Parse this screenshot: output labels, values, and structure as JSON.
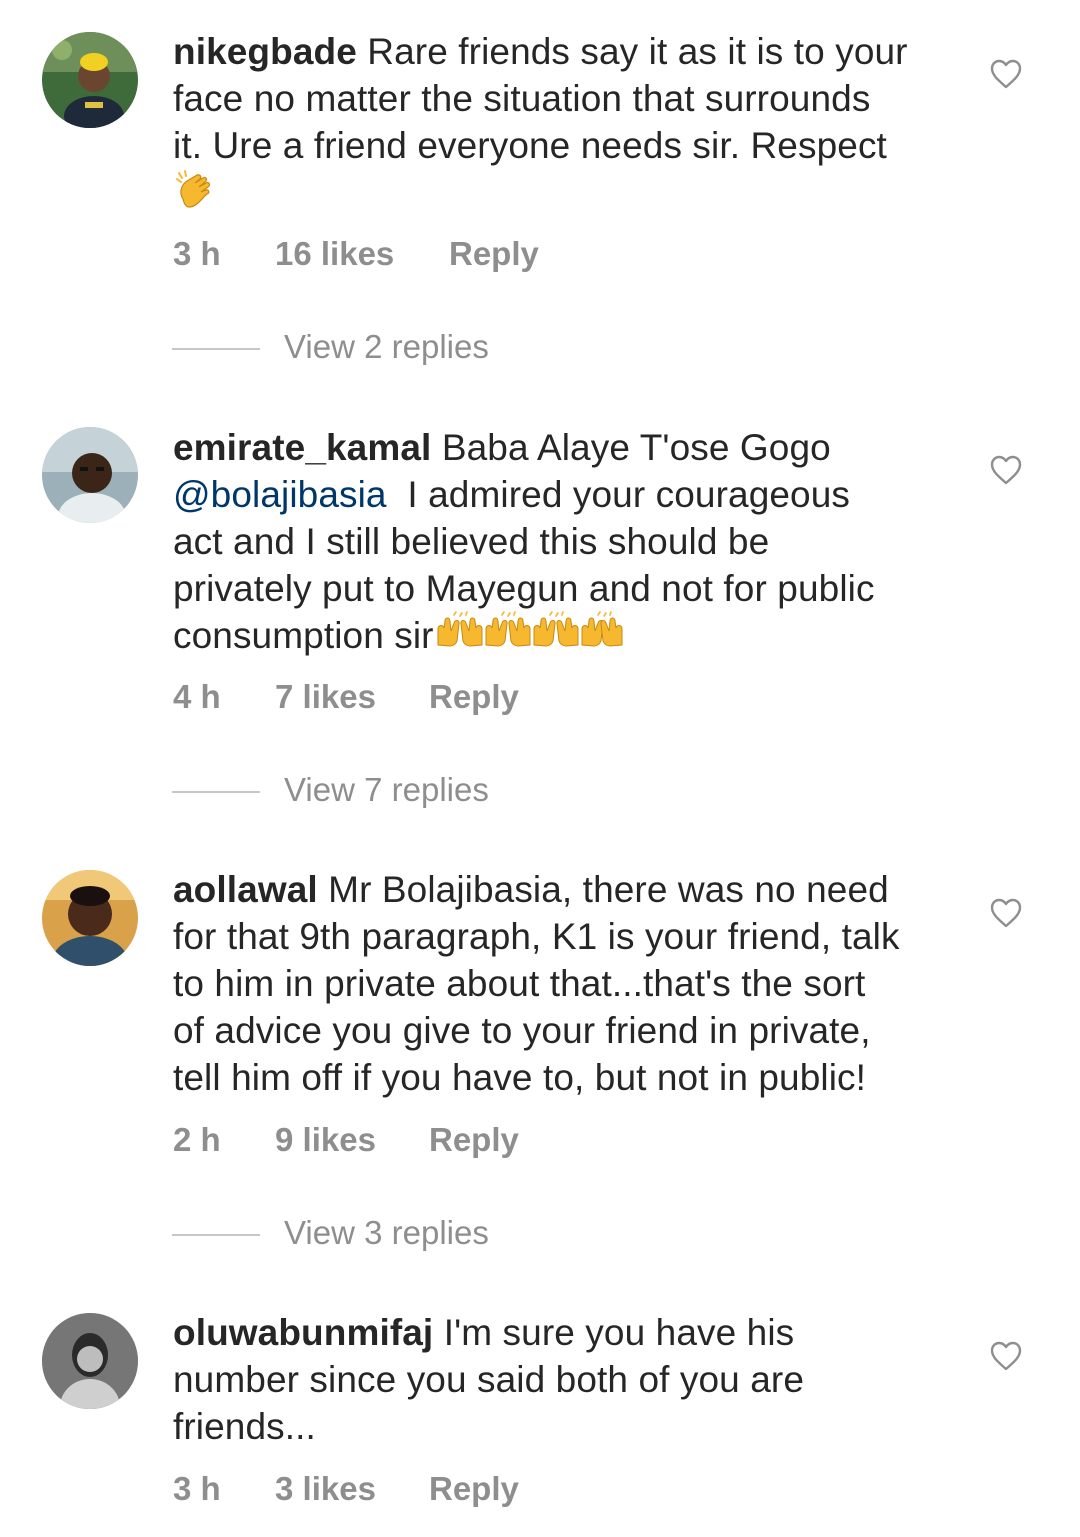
{
  "comments": [
    {
      "username": "nikegbade",
      "lines": [
        {
          "pre": "Rare friends say it as it is to your",
          "mention": "",
          "post": ""
        },
        {
          "pre": "face no matter the situation that surrounds",
          "mention": "",
          "post": ""
        },
        {
          "pre": "it.  Ure a friend everyone needs sir. Respect",
          "mention": "",
          "post": ""
        }
      ],
      "emoji": "👏",
      "time": "3 h",
      "likes": "16 likes",
      "reply": "Reply",
      "view_replies": "View 2 replies"
    },
    {
      "username": "emirate_kamal",
      "lines": [
        {
          "pre": "Baba Alaye T'ose Gogo",
          "mention": "",
          "post": ""
        },
        {
          "pre": "",
          "mention": "@bolajibasia",
          "post": "  I admired your courageous"
        },
        {
          "pre": "act and I still believed this should be",
          "mention": "",
          "post": ""
        },
        {
          "pre": "privately put to Mayegun and not for public",
          "mention": "",
          "post": ""
        },
        {
          "pre": "consumption sir",
          "mention": "",
          "post": ""
        }
      ],
      "emoji": "🙌🙌🙌🙌",
      "time": "4 h",
      "likes": "7 likes",
      "reply": "Reply",
      "view_replies": "View 7 replies"
    },
    {
      "username": "aollawal",
      "lines": [
        {
          "pre": "Mr Bolajibasia, there was no need",
          "mention": "",
          "post": ""
        },
        {
          "pre": "for that 9th paragraph, K1 is your friend, talk",
          "mention": "",
          "post": ""
        },
        {
          "pre": "to him in private about that...that's the sort",
          "mention": "",
          "post": ""
        },
        {
          "pre": "of advice you give to your friend in private,",
          "mention": "",
          "post": ""
        },
        {
          "pre": "tell him off if you have to, but not in public!",
          "mention": "",
          "post": ""
        }
      ],
      "emoji": "",
      "time": "2 h",
      "likes": "9 likes",
      "reply": "Reply",
      "view_replies": "View 3 replies"
    },
    {
      "username": "oluwabunmifaj",
      "lines": [
        {
          "pre": "I'm sure you have his",
          "mention": "",
          "post": ""
        },
        {
          "pre": "number since you said both of you are",
          "mention": "",
          "post": ""
        },
        {
          "pre": "friends...",
          "mention": "",
          "post": ""
        }
      ],
      "emoji": "",
      "time": "3 h",
      "likes": "3 likes",
      "reply": "Reply",
      "view_replies": ""
    }
  ],
  "colors": {
    "text": "#262626",
    "meta": "#8e8e8e",
    "mention": "#00376b",
    "rule": "#c7c7c7"
  },
  "icons": {
    "heart": "heart-outline-icon",
    "clap": "clapping-hands-emoji",
    "raised_hands": "raising-hands-emoji"
  }
}
